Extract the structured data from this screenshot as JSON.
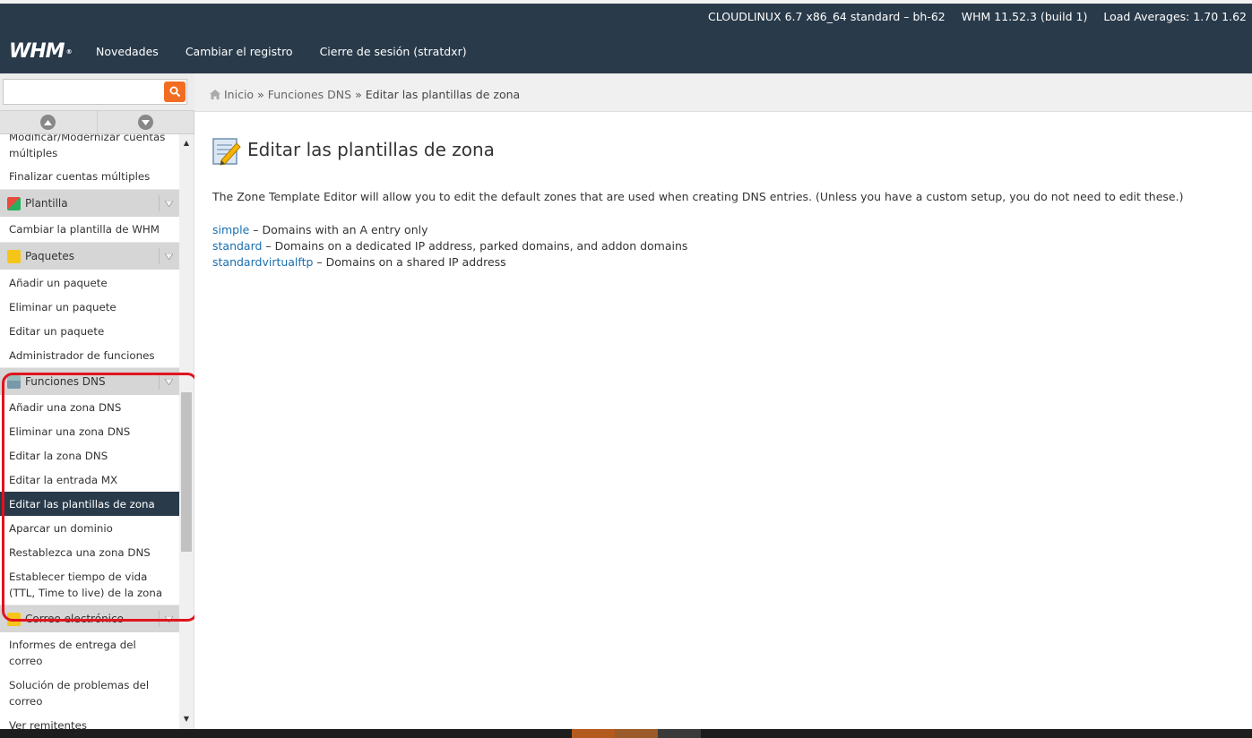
{
  "header": {
    "logo": "WHM",
    "sysinfo": {
      "os": "CLOUDLINUX 6.7 x86_64 standard – bh-62",
      "version": "WHM 11.52.3 (build 1)",
      "load": "Load Averages: 1.70 1.62"
    },
    "nav": [
      "Novedades",
      "Cambiar el registro",
      "Cierre de sesión (stratdxr)"
    ]
  },
  "search": {
    "value": "",
    "placeholder": ""
  },
  "breadcrumb": [
    "Inicio",
    "Funciones DNS",
    "Editar las plantillas de zona"
  ],
  "sidebar": {
    "top_links": [
      "Modificar/Modernizar cuentas múltiples",
      "Finalizar cuentas múltiples"
    ],
    "sections": [
      {
        "title": "Plantilla",
        "items": [
          "Cambiar la plantilla de WHM"
        ]
      },
      {
        "title": "Paquetes",
        "items": [
          "Añadir un paquete",
          "Eliminar un paquete",
          "Editar un paquete",
          "Administrador de funciones"
        ]
      },
      {
        "title": "Funciones DNS",
        "items": [
          "Añadir una zona DNS",
          "Eliminar una zona DNS",
          "Editar la zona DNS",
          "Editar la entrada MX",
          "Editar las plantillas de zona",
          "Aparcar un dominio",
          "Restablezca una zona DNS",
          "Establecer tiempo de vida (TTL, Time to live) de la zona"
        ]
      },
      {
        "title": "Correo electrónico",
        "items": [
          "Informes de entrega del correo",
          "Solución de problemas del correo",
          "Ver remitentes"
        ]
      }
    ],
    "active_item": "Editar las plantillas de zona"
  },
  "main": {
    "title": "Editar las plantillas de zona",
    "intro": "The Zone Template Editor will allow you to edit the default zones that are used when creating DNS entries. (Unless you have a custom setup, you do not need to edit these.)",
    "templates": [
      {
        "name": "simple",
        "desc": " – Domains with an A entry only"
      },
      {
        "name": "standard",
        "desc": " – Domains on a dedicated IP address, parked domains, and addon domains"
      },
      {
        "name": "standardvirtualftp",
        "desc": " – Domains on a shared IP address"
      }
    ]
  },
  "colors": {
    "header_bg": "#293a4a",
    "accent": "#f26d21",
    "link": "#1a6fb0",
    "highlight": "#e0141e"
  },
  "icons": {
    "search": "magnifier-icon",
    "home": "home-icon",
    "title": "edit-document-icon"
  }
}
